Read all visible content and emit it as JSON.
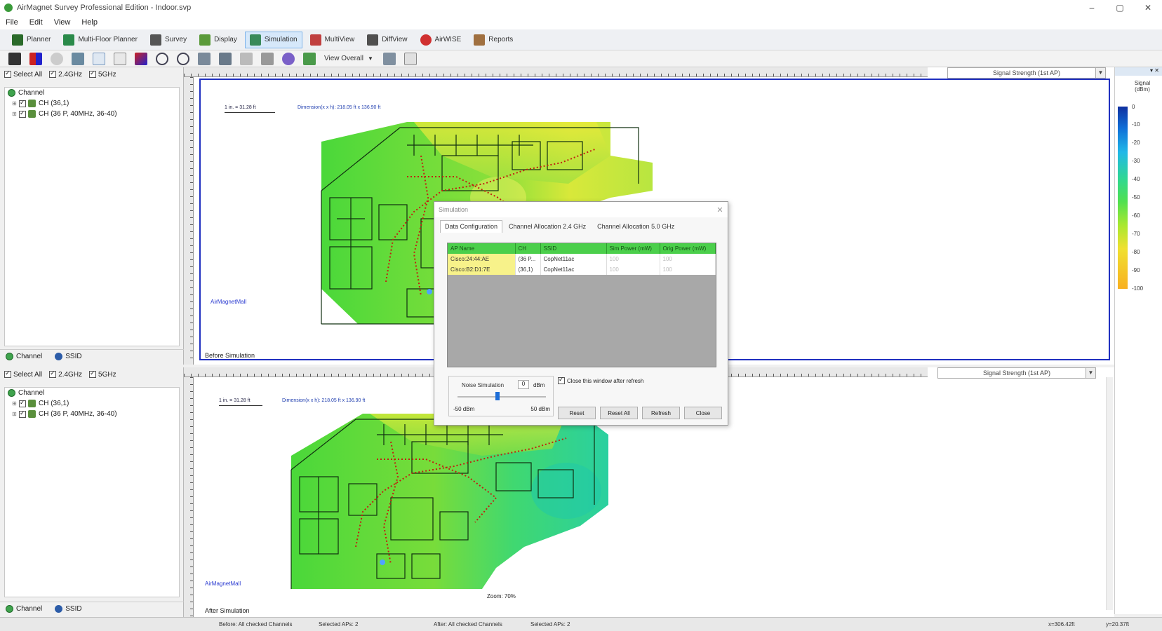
{
  "window": {
    "title": "AirMagnet Survey Professional Edition - Indoor.svp",
    "controls": [
      "–",
      "▢",
      "✕"
    ]
  },
  "menu": [
    "File",
    "Edit",
    "View",
    "Help"
  ],
  "modes": [
    {
      "label": "Planner",
      "icon": "planner-icon",
      "color": "#2a6a2a"
    },
    {
      "label": "Multi-Floor Planner",
      "icon": "multi-floor-icon",
      "color": "#2a8a4a"
    },
    {
      "label": "Survey",
      "icon": "survey-icon",
      "color": "#555555"
    },
    {
      "label": "Display",
      "icon": "display-icon",
      "color": "#5a9a3a"
    },
    {
      "label": "Simulation",
      "icon": "simulation-icon",
      "color": "#3a8a5a",
      "active": true
    },
    {
      "label": "MultiView",
      "icon": "multiview-icon",
      "color": "#c04040"
    },
    {
      "label": "DiffView",
      "icon": "diffview-icon",
      "color": "#505050"
    },
    {
      "label": "AirWISE",
      "icon": "airwise-icon",
      "color": "#d03030"
    },
    {
      "label": "Reports",
      "icon": "reports-icon",
      "color": "#a07040"
    }
  ],
  "view_select": "View Overall",
  "filters": {
    "select_all": "Select All",
    "band_24": "2.4GHz",
    "band_5": "5GHz"
  },
  "tree": {
    "root": "Channel",
    "items": [
      "CH (36,1)",
      "CH (36 P, 40MHz, 36-40)"
    ]
  },
  "panel_tabs": {
    "channel": "Channel",
    "ssid": "SSID"
  },
  "panes": {
    "top": {
      "signal_select": "Signal Strength (1st AP)",
      "scale": "1 in. = 31.28 ft",
      "dimensions": "Dimension(x x h): 218.05 ft x 136.90 ft",
      "ap_label": "AirMagnetMall",
      "label": "Before Simulation"
    },
    "bottom": {
      "signal_select": "Signal Strength (1st AP)",
      "scale": "1 in. = 31.28 ft",
      "dimensions": "Dimension(x x h): 218.05 ft x 136.90 ft",
      "ap_label": "AirMagnetMall",
      "zoom": "Zoom: 70%",
      "label": "After Simulation"
    }
  },
  "legend": {
    "title": "Signal (dBm)",
    "ticks": [
      "0",
      "-10",
      "-20",
      "-30",
      "-40",
      "-50",
      "-60",
      "-70",
      "-80",
      "-90",
      "-100"
    ],
    "gradient": [
      "#1030a0",
      "#1070d8",
      "#20b8e8",
      "#30d890",
      "#50e050",
      "#a8e830",
      "#f0e030",
      "#f8b020"
    ]
  },
  "dialog": {
    "title": "Simulation",
    "tabs": [
      "Data Configuration",
      "Channel Allocation 2.4 GHz",
      "Channel Allocation 5.0 GHz"
    ],
    "columns": [
      "AP Name",
      "CH",
      "SSID",
      "Sim Power (mW)",
      "Orig Power (mW)"
    ],
    "rows": [
      [
        "Cisco:24:44:AE",
        "(36 P...",
        "CopNet11ac",
        "100",
        "100"
      ],
      [
        "Cisco:B2:D1:7E",
        "(36,1)",
        "CopNet11ac",
        "100",
        "100"
      ]
    ],
    "noise_label": "Noise Simulation",
    "noise_value": "0",
    "noise_unit": "dBm",
    "noise_min": "-50 dBm",
    "noise_max": "50 dBm",
    "close_after_refresh": "Close this window after refresh",
    "buttons": [
      "Reset",
      "Reset All",
      "Refresh",
      "Close"
    ]
  },
  "status": {
    "before": "Before: All checked Channels",
    "before_aps": "Selected APs: 2",
    "after": "After: All checked Channels",
    "after_aps": "Selected APs: 2",
    "x_coord": "x=306.42ft",
    "y_coord": "y=20.37ft"
  }
}
